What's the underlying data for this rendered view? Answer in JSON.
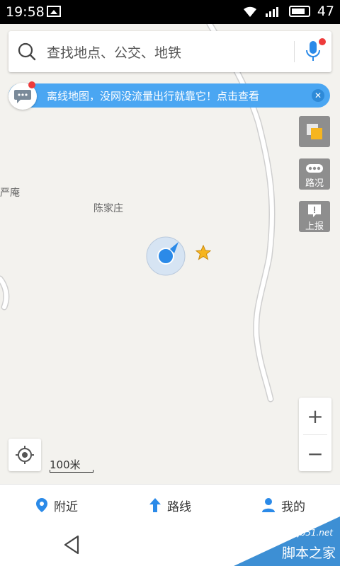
{
  "status_bar": {
    "time": "19:58",
    "battery": "47"
  },
  "search": {
    "placeholder": "查找地点、公交、地铁"
  },
  "banner": {
    "text": "离线地图，没网没流量出行就靠它！点击查看"
  },
  "side_buttons": {
    "traffic_label": "路况",
    "report_label": "上报"
  },
  "map": {
    "labels": [
      "严庵",
      "陈家庄"
    ],
    "scale_label": "100米",
    "colors": {
      "road": "#ffffff",
      "road_edge": "#cfcfcf",
      "accent": "#2b8ae8"
    }
  },
  "zoom": {
    "in_label": "+",
    "out_label": "−"
  },
  "bottom_nav": [
    {
      "label": "附近",
      "icon": "location-pin-icon"
    },
    {
      "label": "路线",
      "icon": "arrow-up-icon"
    },
    {
      "label": "我的",
      "icon": "person-icon"
    }
  ],
  "watermark": {
    "site": "jb51.net",
    "brand": "脚本之家"
  }
}
